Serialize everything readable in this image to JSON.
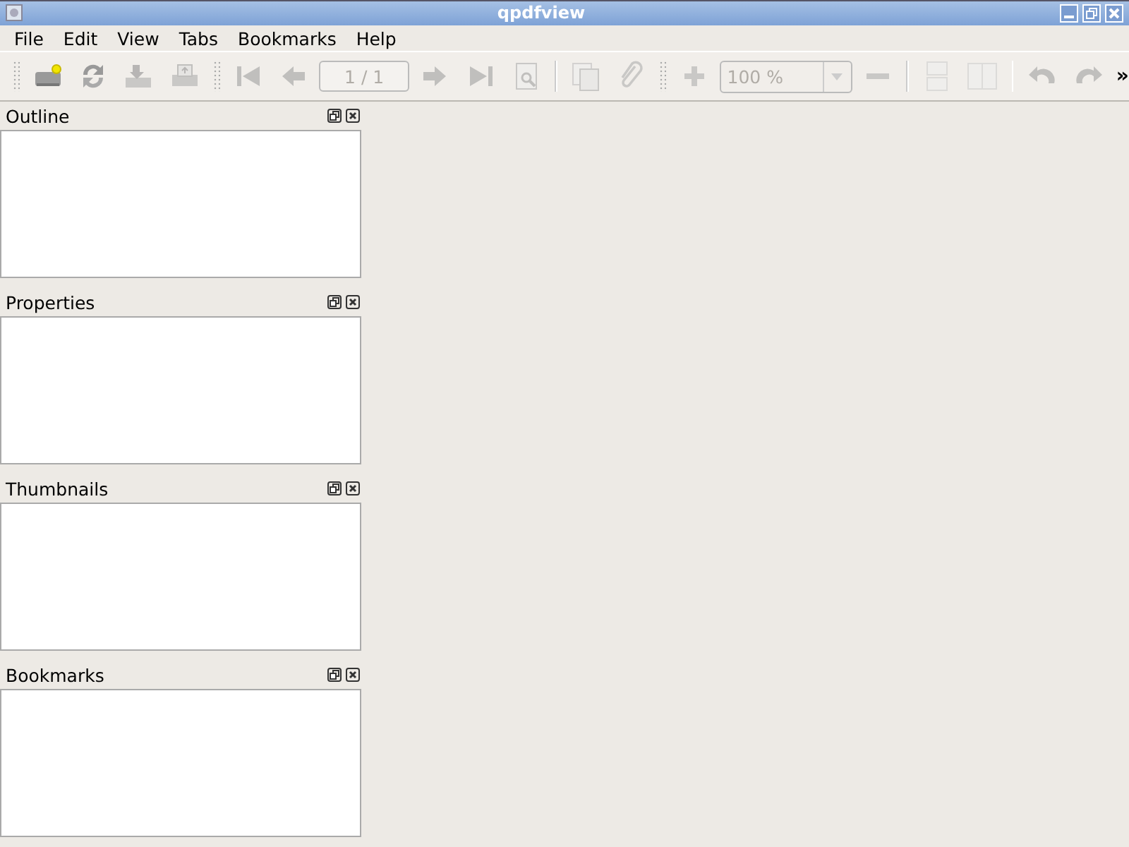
{
  "window": {
    "title": "qpdfview"
  },
  "menu": [
    "File",
    "Edit",
    "View",
    "Tabs",
    "Bookmarks",
    "Help"
  ],
  "toolbar": {
    "buttons": [
      {
        "disabled": false
      },
      {
        "disabled": false
      },
      {
        "disabled": true
      },
      {
        "disabled": true
      },
      {
        "disabled": true
      },
      {
        "disabled": true
      },
      {
        "disabled": true
      },
      {
        "disabled": true
      },
      {
        "disabled": true
      },
      {
        "disabled": true
      },
      {
        "disabled": true
      },
      {
        "disabled": true
      },
      {
        "disabled": true
      },
      {
        "disabled": true
      },
      {
        "disabled": true
      },
      {
        "disabled": true
      },
      {
        "disabled": true
      }
    ],
    "page_field": {
      "value": "1 / 1",
      "disabled": true
    },
    "zoom_combo": {
      "value": "100 %",
      "disabled": true
    },
    "overflow": "»"
  },
  "docks": [
    {
      "title": "Outline"
    },
    {
      "title": "Properties"
    },
    {
      "title": "Thumbnails"
    },
    {
      "title": "Bookmarks"
    }
  ]
}
